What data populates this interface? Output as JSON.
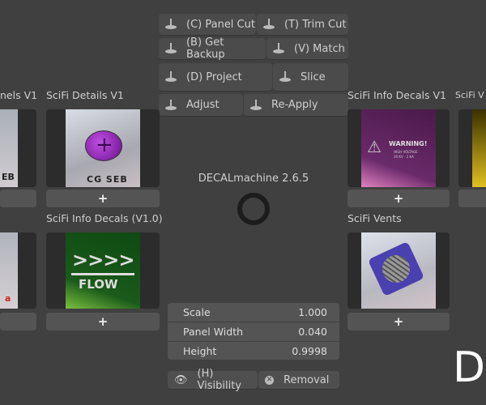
{
  "tools": [
    {
      "label": "(C) Panel Cut"
    },
    {
      "label": "(T) Trim Cut"
    },
    {
      "label": "(B) Get Backup"
    },
    {
      "label": "(V) Match"
    },
    {
      "label": "(D) Project"
    },
    {
      "label": "Slice"
    },
    {
      "label": "Adjust"
    },
    {
      "label": "Re-Apply"
    }
  ],
  "libraries": [
    {
      "name": "nels V1",
      "thumb_text": "EB"
    },
    {
      "name": "SciFi Details V1",
      "thumb_text": "CG SEB"
    },
    {
      "name": "",
      "thumb_text": "a"
    },
    {
      "name": "SciFi Info Decals (V1.0)",
      "thumb_text": "FLOW",
      "arrows": ">>>>"
    },
    {
      "name": "SciFi Info Decals V1",
      "thumb_text": "WARNING!",
      "sub": "HIGH VOLTAGE",
      "sub2": "20 KV - 2 KA"
    },
    {
      "name": "SciFi Vents"
    },
    {
      "name": "SciFi V"
    }
  ],
  "add_label": "+",
  "center": {
    "title": "DECALmachine 2.6.5"
  },
  "props": [
    {
      "label": "Scale",
      "value": "1.000"
    },
    {
      "label": "Panel Width",
      "value": "0.040"
    },
    {
      "label": "Height",
      "value": "0.9998"
    }
  ],
  "visibility_label": "(H) Visibility",
  "removal_label": "Removal",
  "big_letter": "D"
}
